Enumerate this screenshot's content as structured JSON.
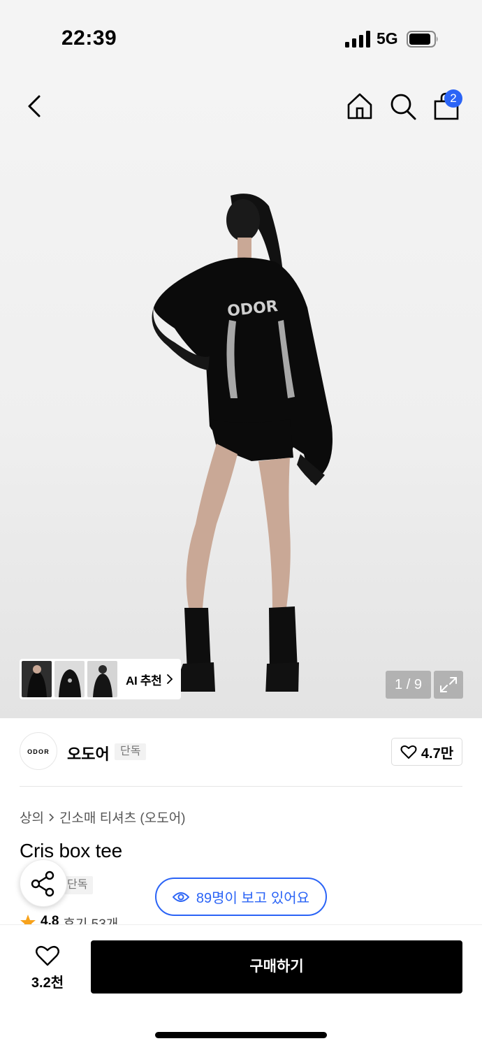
{
  "status_bar": {
    "time": "22:39",
    "network": "5G"
  },
  "nav": {
    "cart_count": "2",
    "icons": [
      "back-icon",
      "home-icon",
      "search-icon",
      "shopping-bag-icon"
    ]
  },
  "gallery": {
    "ai_recommend_label": "AI 추천",
    "page_indicator": "1 / 9",
    "model_logo_text": "ODOR"
  },
  "brand": {
    "logo_text": "ODOR",
    "name": "오도어",
    "tag": "단독",
    "like_count": "4.7만"
  },
  "product": {
    "breadcrumb": [
      "상의",
      "긴소매 티셔츠 (오도어)"
    ],
    "title": "Cris box tee",
    "exclusive_tag": "단독",
    "rating": "4.8",
    "reviews": "후기 53개"
  },
  "viewers_text": "89명이 보고 있어요",
  "bottom_bar": {
    "wish_count": "3.2천",
    "buy_label": "구매하기"
  },
  "colors": {
    "accent_blue": "#2b64f6",
    "button_black": "#000000",
    "star": "#f7a21b"
  }
}
